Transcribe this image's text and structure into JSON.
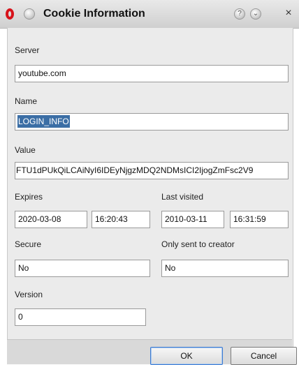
{
  "window": {
    "title": "Cookie Information",
    "help_glyph": "?",
    "menu_glyph": "⌄",
    "close_glyph": "×"
  },
  "form": {
    "server": {
      "label": "Server",
      "value": "youtube.com"
    },
    "name": {
      "label": "Name",
      "value": "LOGIN_INFO"
    },
    "value": {
      "label": "Value",
      "value": "FTU1dPUkQiLCAiNyI6IDEyNjgzMDQ2NDMsICI2IjogZmFsc2V9"
    },
    "expires": {
      "label": "Expires",
      "date": "2020-03-08",
      "time": "16:20:43"
    },
    "last_visited": {
      "label": "Last visited",
      "date": "2010-03-11",
      "time": "16:31:59"
    },
    "secure": {
      "label": "Secure",
      "value": "No"
    },
    "only_sent_to_creator": {
      "label": "Only sent to creator",
      "value": "No"
    },
    "version": {
      "label": "Version",
      "value": "0"
    }
  },
  "buttons": {
    "ok": "OK",
    "cancel": "Cancel"
  },
  "colors": {
    "selection": "#3b6ea5",
    "opera_red": "#d7131b",
    "ok_border": "#3d7bd1"
  }
}
